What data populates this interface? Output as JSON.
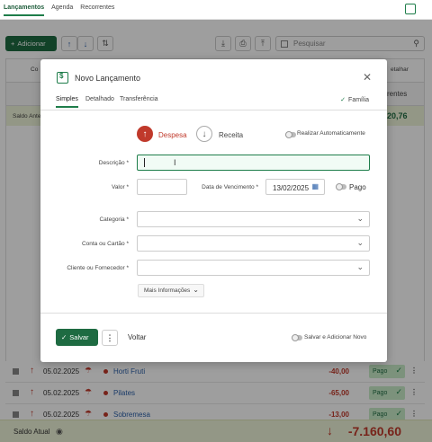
{
  "topbar": {
    "tabs": [
      "Lançamentos",
      "Agenda",
      "Recorrentes"
    ]
  },
  "toolbar": {
    "add_label": "Adicionar",
    "search_placeholder": "Pesquisar"
  },
  "rows": [
    {
      "date": "05.02.2025",
      "name": "Horti Fruti",
      "value": "-40,00",
      "status": "Pago"
    },
    {
      "date": "05.02.2025",
      "name": "Pilates",
      "value": "-65,00",
      "status": "Pago"
    },
    {
      "date": "05.02.2025",
      "name": "Sobremesa",
      "value": "-13,00",
      "status": "Pago"
    }
  ],
  "saldo": {
    "label": "Saldo Atual",
    "amount": "-7.160,60"
  },
  "peek": {
    "rentes": "rentes",
    "value": "20,76",
    "detalhar": "etalhar",
    "co": "Co",
    "saldo_ant": "Saldo Ante"
  },
  "modal": {
    "title": "Novo Lançamento",
    "tabs": [
      "Simples",
      "Detalhado",
      "Transferência"
    ],
    "familia": "Família",
    "despesa": "Despesa",
    "receita": "Receita",
    "auto": "Realizar Automaticamente",
    "fields": {
      "descricao": "Descrição *",
      "valor": "Valor *",
      "vencimento": "Data de Vencimento *",
      "vencimento_value": "13/02/2025",
      "pago": "Pago",
      "categoria": "Categoria *",
      "conta": "Conta ou Cartão *",
      "cliente": "Cliente ou Fornecedor *"
    },
    "mais": "Mais Informações",
    "salvar": "Salvar",
    "voltar": "Voltar",
    "salvar_novo": "Salvar e Adicionar Novo"
  },
  "colors": {
    "primary": "#1e6b42",
    "expense": "#c0392b",
    "link": "#2a5fa8"
  }
}
